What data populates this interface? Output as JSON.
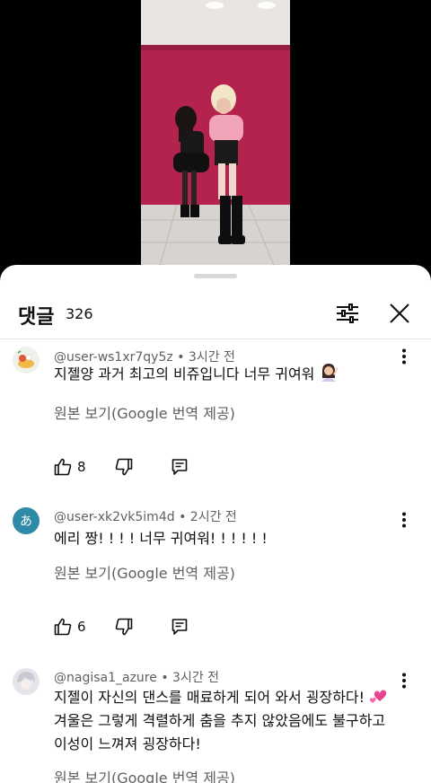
{
  "sheet": {
    "title": "댓글",
    "count": "326"
  },
  "icons": {
    "filter": "filter-sliders-icon",
    "close": "close-icon",
    "more": "more-vertical-icon",
    "like": "thumbs-up-icon",
    "dislike": "thumbs-down-icon",
    "reply": "reply-icon"
  },
  "comments": [
    {
      "author": "@user-ws1xr7qy5z",
      "time": "3시간 전",
      "text": "지젤양 과거 최고의 비쥬입니다 너무 귀여워",
      "emoji": "woman-raising-hand-emoji",
      "translate": "원본 보기(Google 번역 제공)",
      "likes": "8"
    },
    {
      "author": "@user-xk2vk5im4d",
      "time": "2시간 전",
      "avatar_letter": "あ",
      "avatar_color": "#2f8aa8",
      "text": "에리 짱! ! ! ! 너무 귀여워! ! ! ! ! !",
      "translate": "원본 보기(Google 번역 제공)",
      "likes": "6"
    },
    {
      "author": "@nagisa1_azure",
      "time": "3시간 전",
      "text_line1": "지젤이 자신의 댄스를 매료하게 되어 와서 굉장하다! ",
      "emoji": "two-hearts-emoji",
      "text_line2": "겨울은 그렇게 격렬하게 춤을 추지 않았음에도 불구하고",
      "text_line3": "이성이 느껴져 굉장하다!",
      "translate": "원본 보기(Google 번역 제공)"
    }
  ]
}
